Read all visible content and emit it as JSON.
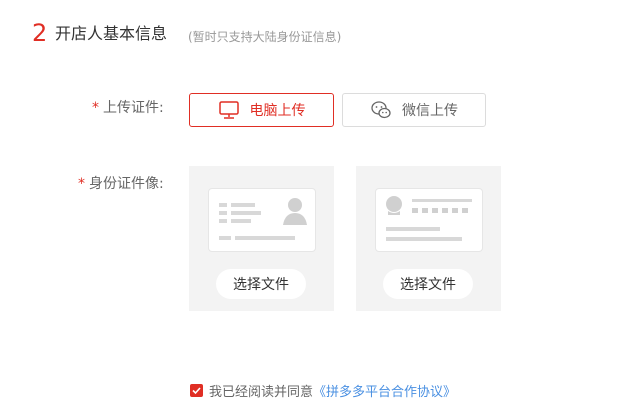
{
  "section": {
    "number": "2",
    "title": "开店人基本信息",
    "note": "(暂时只支持大陆身份证信息)"
  },
  "upload_method": {
    "required_mark": "*",
    "label": "上传证件:",
    "pc_button": "电脑上传",
    "wechat_button": "微信上传",
    "pc_icon": "monitor-icon",
    "wechat_icon": "wechat-icon",
    "accent_color": "#e02e24"
  },
  "id_photo": {
    "required_mark": "*",
    "label": "身份证件像:",
    "cards": [
      {
        "illustration": "id-card-front-icon",
        "button": "选择文件"
      },
      {
        "illustration": "id-card-back-icon",
        "button": "选择文件"
      }
    ]
  },
  "agreement": {
    "checked": true,
    "text": "我已经阅读并同意",
    "link_text": "《拼多多平台合作协议》",
    "link_color": "#4a90e2"
  }
}
